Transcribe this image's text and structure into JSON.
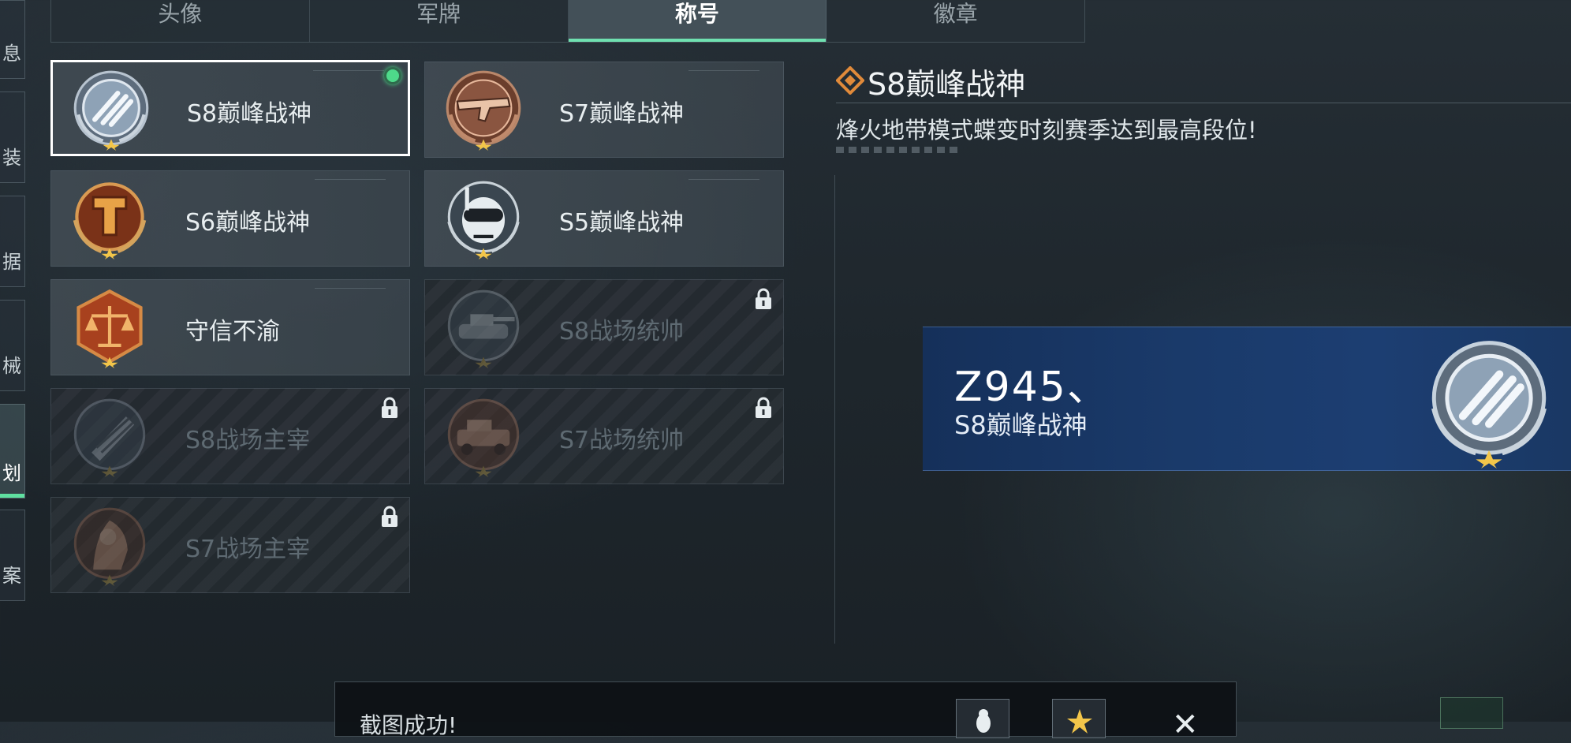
{
  "sidebar": {
    "items": [
      {
        "label": "息"
      },
      {
        "label": "装"
      },
      {
        "label": "据"
      },
      {
        "label": "械"
      },
      {
        "label": "划",
        "active": true
      },
      {
        "label": "案"
      }
    ]
  },
  "tabs": [
    {
      "label": "头像"
    },
    {
      "label": "军牌"
    },
    {
      "label": "称号",
      "active": true
    },
    {
      "label": "徽章"
    }
  ],
  "titles": [
    {
      "label": "S8巅峰战神",
      "icon": "wings-emblem-icon",
      "locked": false,
      "selected": true,
      "equipped": true
    },
    {
      "label": "S7巅峰战神",
      "icon": "rifle-emblem-icon",
      "locked": false
    },
    {
      "label": "S6巅峰战神",
      "icon": "hammer-emblem-icon",
      "locked": false
    },
    {
      "label": "S5巅峰战神",
      "icon": "skull-diver-emblem-icon",
      "locked": false
    },
    {
      "label": "守信不渝",
      "icon": "scales-emblem-icon",
      "locked": false
    },
    {
      "label": "S8战场统帅",
      "icon": "tank-emblem-icon",
      "locked": true
    },
    {
      "label": "S8战场主宰",
      "icon": "launcher-emblem-icon",
      "locked": true
    },
    {
      "label": "S7战场统帅",
      "icon": "vehicle-emblem-icon",
      "locked": true
    },
    {
      "label": "S7战场主宰",
      "icon": "soldier-emblem-icon",
      "locked": true
    }
  ],
  "detail": {
    "title": "S8巅峰战神",
    "description": "烽火地带模式蝶变时刻赛季达到最高段位!"
  },
  "preview": {
    "player_name": "Z945、",
    "title": "S8巅峰战神"
  },
  "toast": {
    "message": "截图成功!"
  },
  "colors": {
    "accent": "#5fe0a0",
    "banner": "#1a3a6a",
    "equipped": "#4ed98a"
  }
}
